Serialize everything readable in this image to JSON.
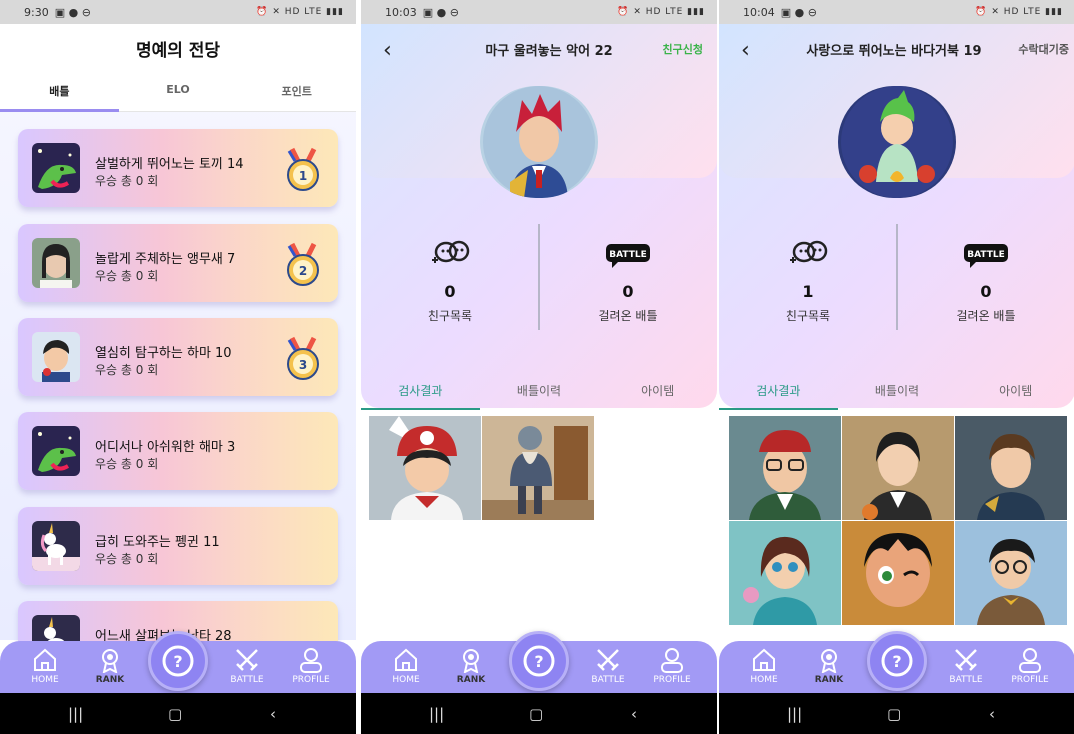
{
  "status": {
    "screen1_time": "9:30",
    "screen2_time": "10:03",
    "screen3_time": "10:04",
    "indicators": "HD LTE"
  },
  "hall_of_fame": {
    "title": "명예의 전당",
    "tabs": [
      "배틀",
      "ELO",
      "포인트"
    ],
    "active_tab": "배틀",
    "entries": [
      {
        "name": "살벌하게 뛰어노는 토끼 14",
        "wins": "우승 총 0 회",
        "medal": "1",
        "avatar_icon": "crocodile-avatar-icon"
      },
      {
        "name": "놀랍게 주체하는 앵무새 7",
        "wins": "우승 총 0 회",
        "medal": "2",
        "avatar_icon": "woman-photo-avatar-icon"
      },
      {
        "name": "열심히 탐구하는 하마 10",
        "wins": "우승 총 0 회",
        "medal": "3",
        "avatar_icon": "boy-avatar-icon"
      },
      {
        "name": "어디서나 아쉬워한 해마 3",
        "wins": "우승 총 0 회",
        "medal": "",
        "avatar_icon": "crocodile-avatar-icon"
      },
      {
        "name": "급히 도와주는 펭귄 11",
        "wins": "우승 총 0 회",
        "medal": "",
        "avatar_icon": "unicorn-avatar-icon"
      },
      {
        "name": "어느새 살펴보는 낙타 28",
        "wins": "",
        "medal": "",
        "avatar_icon": "unicorn-avatar-icon"
      }
    ]
  },
  "profile_a": {
    "title": "마구 울려놓는 악어 22",
    "action": "친구신청",
    "friends_count": "0",
    "friends_label": "친구목록",
    "battles_count": "0",
    "battles_label": "걸려온 배틀",
    "battle_badge": "BATTLE",
    "tabs": [
      "검사결과",
      "배틀이력",
      "아이템"
    ],
    "active_tab": "검사결과"
  },
  "profile_b": {
    "title": "사랑으로 뛰어노는 바다거북 19",
    "action": "수락대기중",
    "friends_count": "1",
    "friends_label": "친구목록",
    "battles_count": "0",
    "battles_label": "걸려온 배틀",
    "battle_badge": "BATTLE",
    "tabs": [
      "검사결과",
      "배틀이력",
      "아이템"
    ],
    "active_tab": "검사결과"
  },
  "nav": {
    "home": "HOME",
    "rank": "RANK",
    "battle": "BATTLE",
    "profile": "PROFILE"
  },
  "colors": {
    "nav_bg": "#a29af5",
    "accent_green": "#3bb34a",
    "tab_teal": "#2a9a86",
    "card_gradient_start": "#d9c7ff",
    "card_gradient_end": "#fde8b8"
  }
}
